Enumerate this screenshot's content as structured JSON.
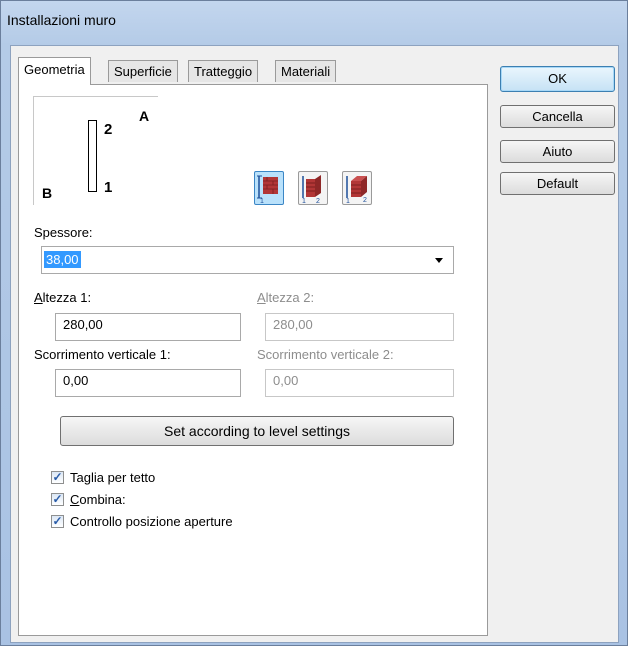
{
  "window": {
    "title": "Installazioni muro"
  },
  "tabs": [
    {
      "label": "Geometria",
      "active": true
    },
    {
      "label": "Superficie",
      "active": false
    },
    {
      "label": "Tratteggio",
      "active": false
    },
    {
      "label": "Materiali",
      "active": false
    }
  ],
  "buttons": {
    "ok": "OK",
    "cancel": "Cancella",
    "help": "Aiuto",
    "default": "Default"
  },
  "preview": {
    "label_a": "A",
    "label_b": "B",
    "label_1": "1",
    "label_2": "2"
  },
  "wall_icons": [
    {
      "name": "wall-layer-left-icon",
      "selected": true
    },
    {
      "name": "wall-layer-center-icon",
      "selected": false
    },
    {
      "name": "wall-layer-right-icon",
      "selected": false
    }
  ],
  "thickness": {
    "label": "Spessore:",
    "value": "38,00"
  },
  "height1": {
    "label_rest": "ltezza 1:",
    "label_first": "A",
    "value": "280,00"
  },
  "height2": {
    "label_rest": "ltezza 2:",
    "label_first": "A",
    "value": "280,00"
  },
  "offset1": {
    "label": "Scorrimento verticale 1:",
    "value": "0,00"
  },
  "offset2": {
    "label": "Scorrimento verticale 2:",
    "value": "0,00"
  },
  "level_button": "Set according to level settings",
  "checkboxes": [
    {
      "label": "Taglia per tetto",
      "checked": true
    },
    {
      "label_first": "C",
      "label_rest": "ombina:",
      "checked": true
    },
    {
      "label": "Controllo posizione aperture",
      "checked": true
    }
  ],
  "colors": {
    "accent": "#3399ff",
    "frame": "#b4cbe7",
    "brick": "#b23636"
  }
}
